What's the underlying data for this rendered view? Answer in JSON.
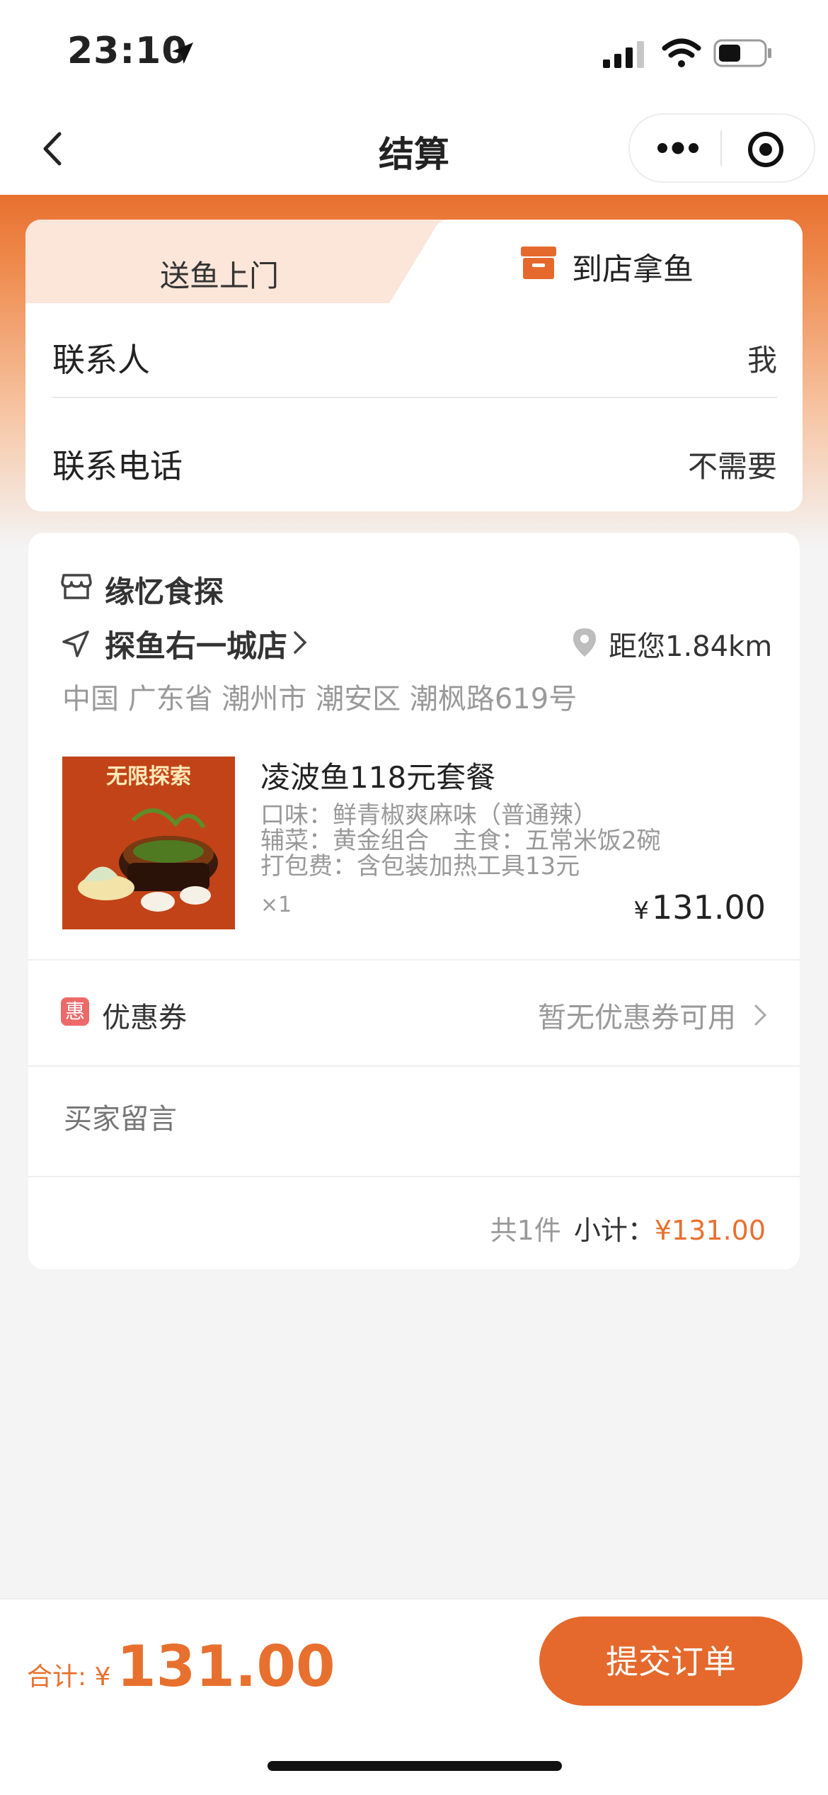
{
  "status_bar": {
    "time": "23:10"
  },
  "nav": {
    "title": "结算"
  },
  "delivery_tabs": {
    "deliver": "送鱼上门",
    "pickup": "到店拿鱼"
  },
  "contact": {
    "contact_label": "联系人",
    "contact_value": "我",
    "phone_label": "联系电话",
    "phone_value": "不需要"
  },
  "shop": {
    "name": "缘忆食探",
    "store_name": "探鱼右一城店",
    "distance": "距您1.84km",
    "address": "中国 广东省 潮州市 潮安区 潮枫路619号"
  },
  "product": {
    "image_text": "无限探索",
    "name": "凌波鱼118元套餐",
    "spec_flavor": "口味：鲜青椒爽麻味（普通辣）",
    "spec_side": "辅菜：黄金组合　主食：五常米饭2碗",
    "spec_pack": "打包费：含包装加热工具13元",
    "qty": "×1",
    "price_symbol": "¥",
    "price": "131.00"
  },
  "coupon": {
    "badge": "惠",
    "label": "优惠券",
    "value": "暂无优惠券可用"
  },
  "message": {
    "placeholder": "买家留言"
  },
  "subtotal": {
    "count": "共1件",
    "label": "小计：",
    "amount": "¥131.00"
  },
  "footer": {
    "total_label": "合计: ¥",
    "total_amount": "131.00",
    "submit": "提交订单"
  },
  "colors": {
    "accent": "#e5692c",
    "orange_light": "#fbe6d9",
    "coupon_badge": "#ed6a6a"
  },
  "icons": [
    "location-arrow-icon",
    "signal-icon",
    "wifi-icon",
    "battery-icon",
    "back-icon",
    "more-icon",
    "target-icon",
    "store-box-icon",
    "shop-icon",
    "navigation-icon",
    "chevron-right-icon",
    "map-pin-icon"
  ]
}
